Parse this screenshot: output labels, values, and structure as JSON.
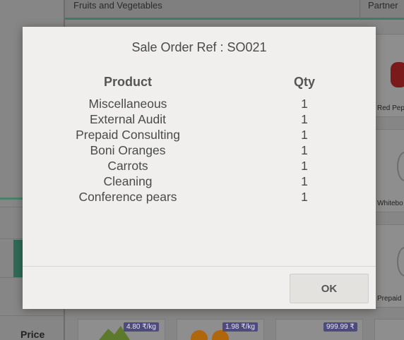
{
  "background": {
    "category_crumb": "Fruits and Vegetables",
    "partner_crumb": "Partner",
    "left_pane": {
      "price_label": "Price"
    },
    "products": [
      {
        "name": "Red Pep",
        "icon": "pepper-image"
      },
      {
        "name": "Whitebo",
        "icon": "placeholder-image"
      },
      {
        "name": "Prepaid",
        "icon": "placeholder-image"
      }
    ],
    "price_tags": [
      "4.80 ₹/kg",
      "1.98 ₹/kg",
      "999.99 ₹"
    ]
  },
  "modal": {
    "title": "Sale Order Ref : SO021",
    "headers": {
      "product": "Product",
      "qty": "Qty"
    },
    "lines": [
      {
        "product": "Miscellaneous",
        "qty": "1"
      },
      {
        "product": "External Audit",
        "qty": "1"
      },
      {
        "product": "Prepaid Consulting",
        "qty": "1"
      },
      {
        "product": "Boni Oranges",
        "qty": "1"
      },
      {
        "product": "Carrots",
        "qty": "1"
      },
      {
        "product": "Cleaning",
        "qty": "1"
      },
      {
        "product": "Conference pears",
        "qty": "1"
      }
    ],
    "ok_label": "OK"
  },
  "colors": {
    "overlay": "#868686",
    "accent_green": "#3f7b67",
    "price_tag": "#4d4a7c",
    "modal_bg": "#f0efed"
  }
}
